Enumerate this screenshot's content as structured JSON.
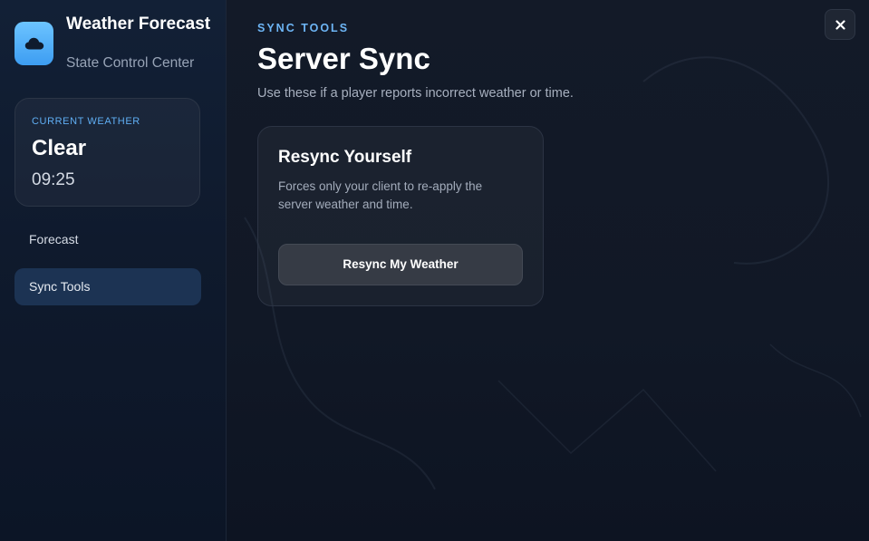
{
  "brand": {
    "title": "Weather Forecast",
    "subtitle": "State Control Center",
    "icon": "cloud-icon"
  },
  "current_weather": {
    "label": "CURRENT WEATHER",
    "condition": "Clear",
    "time": "09:25"
  },
  "nav": {
    "items": [
      {
        "label": "Forecast",
        "active": false
      },
      {
        "label": "Sync Tools",
        "active": true
      }
    ]
  },
  "main": {
    "eyebrow": "SYNC TOOLS",
    "title": "Server Sync",
    "description": "Use these if a player reports incorrect weather or time."
  },
  "resync_card": {
    "title": "Resync Yourself",
    "description": "Forces only your client to re-apply the server weather and time.",
    "button_label": "Resync My Weather"
  },
  "close_button": {
    "icon": "close-icon",
    "glyph": "✕"
  },
  "colors": {
    "accent": "#5faef3",
    "brand_icon": "#4aaaf5",
    "active_nav": "#1c3353"
  }
}
